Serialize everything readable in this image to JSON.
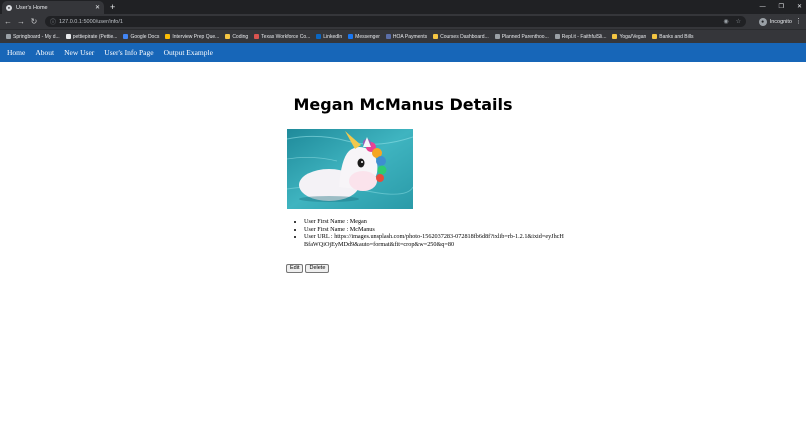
{
  "browser": {
    "tab_title": "User's Home",
    "url": "127.0.0.1:5000/user/info/1",
    "incognito_label": "Incognito",
    "bookmarks": [
      {
        "label": "Springboard - My d...",
        "color": "#9aa0a6"
      },
      {
        "label": "pettiepirate (Pettie...",
        "color": "#e8eaed"
      },
      {
        "label": "Google Docs",
        "color": "#4285f4"
      },
      {
        "label": "Interview Prep Que...",
        "color": "#fbbc04"
      },
      {
        "label": "Coding",
        "color": "#f4c542"
      },
      {
        "label": "Texas Workforce Co...",
        "color": "#d9534f"
      },
      {
        "label": "LinkedIn",
        "color": "#0a66c2"
      },
      {
        "label": "Messenger",
        "color": "#1877f2"
      },
      {
        "label": "HOA Payments",
        "color": "#5a6ea8"
      },
      {
        "label": "Courses Dashboard...",
        "color": "#f4c542"
      },
      {
        "label": "Planned Parenthoo...",
        "color": "#9aa0a6"
      },
      {
        "label": "Repl.it - FaithfulSli...",
        "color": "#9aa0a6"
      },
      {
        "label": "Yoga/Vegan",
        "color": "#f4c542"
      },
      {
        "label": "Banks and Bills",
        "color": "#f4c542"
      }
    ]
  },
  "nav": {
    "items": [
      "Home",
      "About",
      "New User",
      "User's Info Page",
      "Output Example"
    ]
  },
  "page": {
    "title": "Megan McManus Details"
  },
  "details": {
    "first_name": "User First Name : Megan",
    "last_name": "User First Name : McManus",
    "url": "User URL : https://images.unsplash.com/photo-1562037283-072818fb6d8f?ixlib=rb-1.2.1&ixid=eyJhcHBfaWQiOjEyMDd9&auto=format&fit=crop&w=250&q=80"
  },
  "actions": {
    "edit": "Edit",
    "delete": "Delete"
  },
  "colors": {
    "navbar": "#1766b8",
    "chrome_dark": "#202124",
    "chrome_toolbar": "#35363a"
  }
}
